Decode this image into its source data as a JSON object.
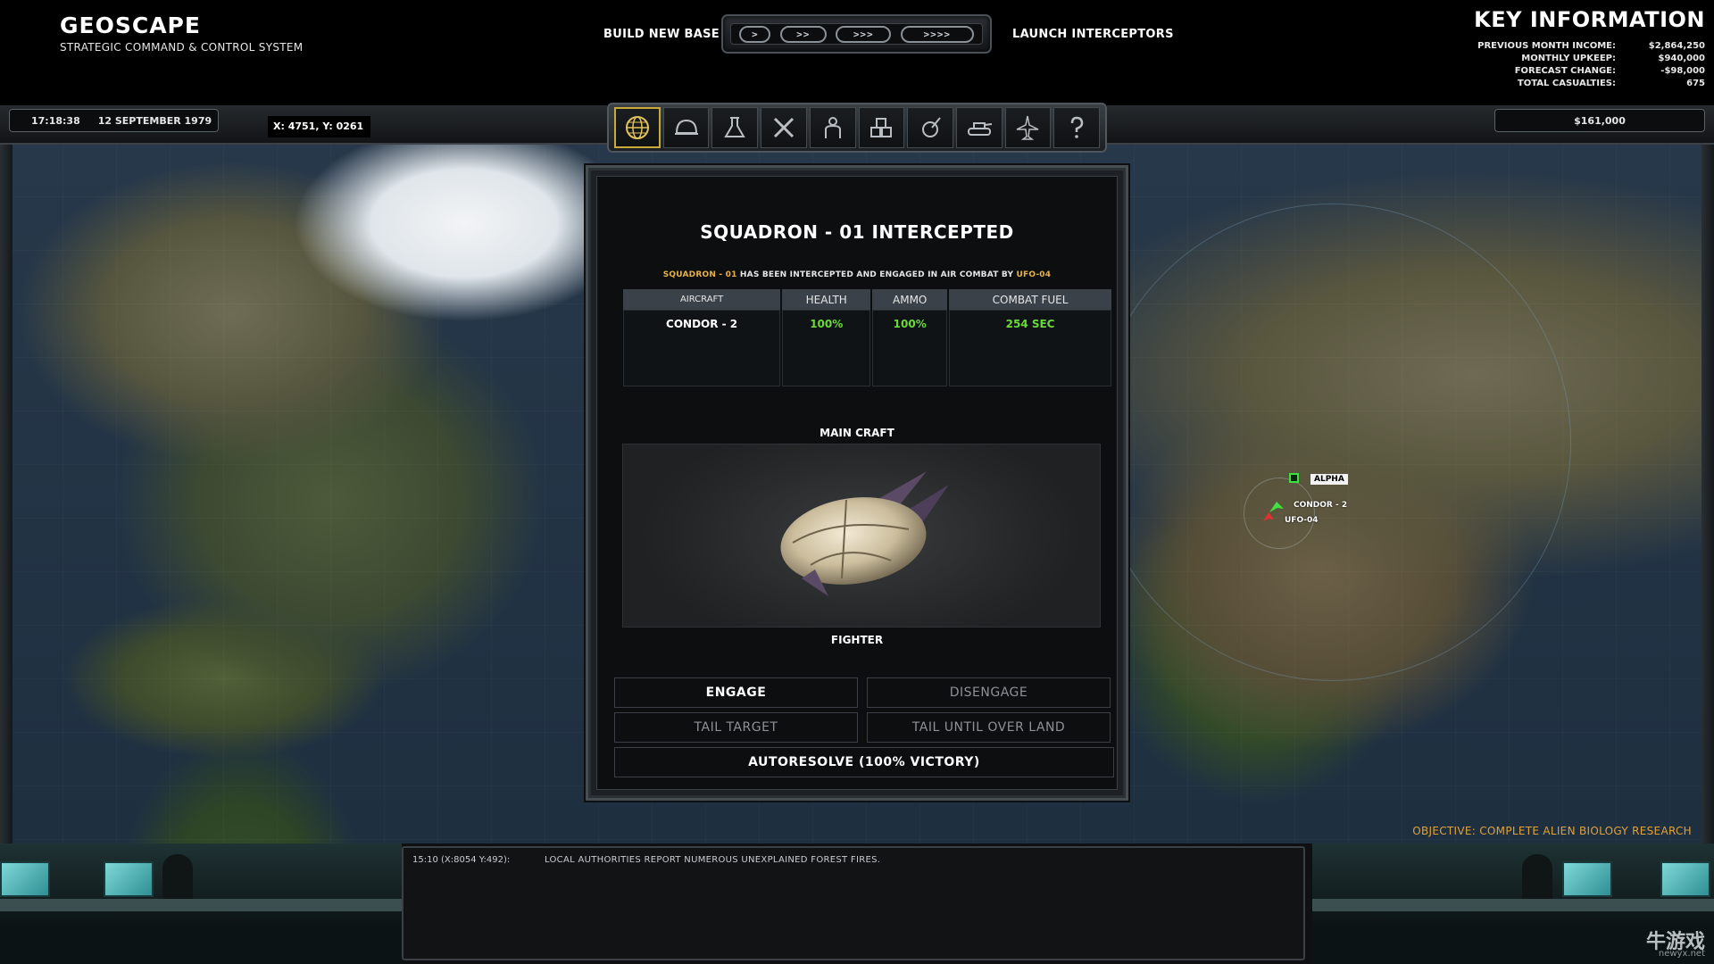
{
  "header": {
    "title": "GEOSCAPE",
    "subtitle": "STRATEGIC COMMAND & CONTROL SYSTEM",
    "build_new_base": "BUILD NEW BASE",
    "launch_interceptors": "LAUNCH INTERCEPTORS",
    "speed_buttons": [
      ">",
      ">>",
      ">>>",
      ">>>>"
    ]
  },
  "key_info": {
    "title": "KEY INFORMATION",
    "rows": [
      {
        "label": "PREVIOUS MONTH INCOME:",
        "value": "$2,864,250"
      },
      {
        "label": "MONTHLY UPKEEP:",
        "value": "$940,000"
      },
      {
        "label": "FORECAST CHANGE:",
        "value": "-$98,000"
      },
      {
        "label": "TOTAL CASUALTIES:",
        "value": "675"
      }
    ]
  },
  "status_bar": {
    "time": "17:18:38",
    "date": "12 SEPTEMBER 1979",
    "coords": "X: 4751, Y: 0261",
    "funds": "$161,000"
  },
  "toolbar": {
    "buttons": [
      {
        "icon": "globe-icon",
        "active": true
      },
      {
        "icon": "helmet-icon",
        "active": false
      },
      {
        "icon": "flask-icon",
        "active": false
      },
      {
        "icon": "tools-icon",
        "active": false
      },
      {
        "icon": "soldier-icon",
        "active": false
      },
      {
        "icon": "storage-icon",
        "active": false
      },
      {
        "icon": "satellite-icon",
        "active": false
      },
      {
        "icon": "tank-icon",
        "active": false
      },
      {
        "icon": "jet-icon",
        "active": false
      },
      {
        "icon": "help-icon",
        "active": false
      }
    ]
  },
  "dialog": {
    "title": "SQUADRON - 01 INTERCEPTED",
    "message_part1": "SQUADRON - 01",
    "message_part2": " HAS BEEN INTERCEPTED AND ENGAGED IN AIR COMBAT BY ",
    "message_part3": "UFO-04",
    "table": {
      "headers": [
        "AIRCRAFT",
        "HEALTH",
        "AMMO",
        "COMBAT FUEL"
      ],
      "rows": [
        [
          "CONDOR - 2",
          "100%",
          "100%",
          "254 SEC"
        ]
      ]
    },
    "main_craft_label": "MAIN CRAFT",
    "craft_type": "FIGHTER",
    "buttons": {
      "engage": "ENGAGE",
      "disengage": "DISENGAGE",
      "tail_target": "TAIL TARGET",
      "tail_until_over_land": "TAIL UNTIL OVER LAND",
      "autoresolve": "AUTORESOLVE (100% VICTORY)"
    }
  },
  "map": {
    "base_label": "ALPHA",
    "aircraft_label": "CONDOR - 2",
    "ufo_label": "UFO-04",
    "objective": "OBJECTIVE: COMPLETE ALIEN BIOLOGY RESEARCH",
    "colors": {
      "base": "#41e041",
      "aircraft": "#41e041",
      "ufo": "#e03030",
      "objective": "#e0a23a",
      "highlight": "#e7b24a"
    }
  },
  "log": {
    "timestamp": "15:10 (X:8054 Y:492):",
    "message": "LOCAL AUTHORITIES REPORT NUMEROUS UNEXPLAINED FOREST FIRES."
  },
  "watermark": {
    "main": "牛游戏",
    "sub": "newyx.net"
  }
}
